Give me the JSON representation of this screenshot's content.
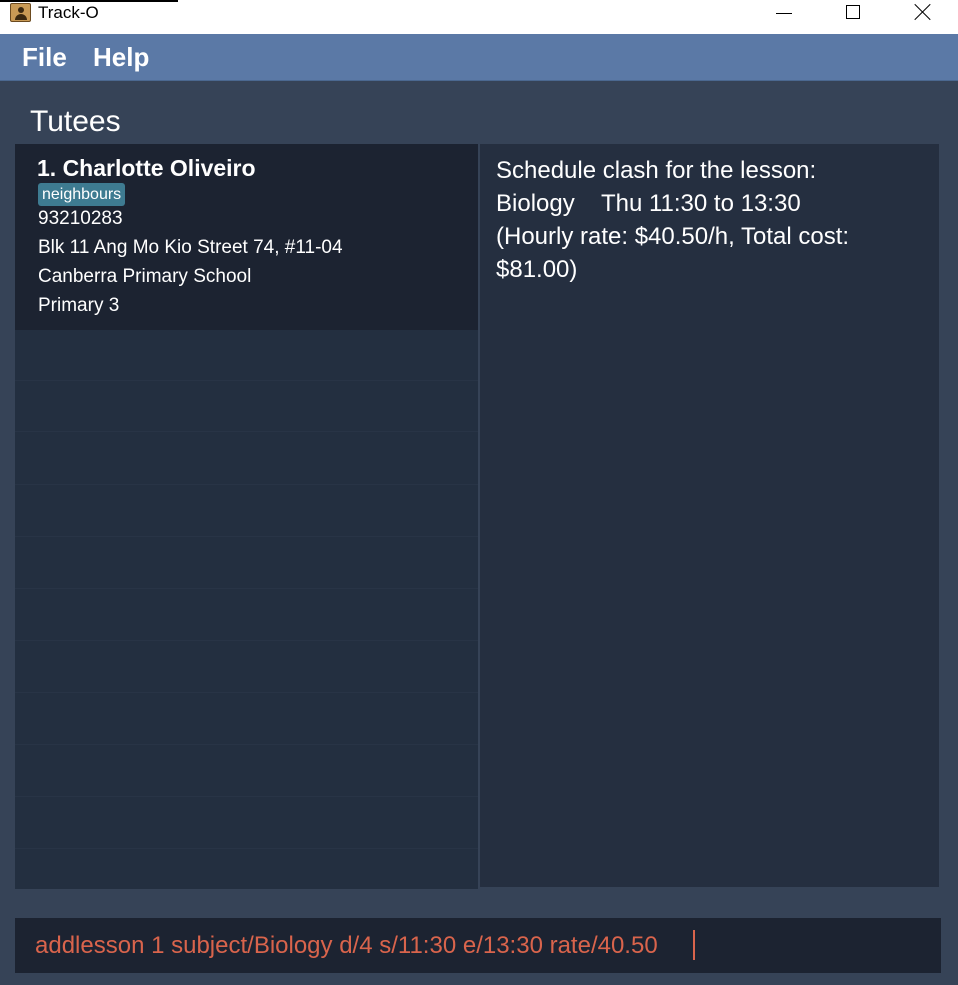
{
  "window": {
    "title": "Track-O",
    "icon": "address-book-icon"
  },
  "menu": {
    "file": "File",
    "help": "Help"
  },
  "main": {
    "section_title": "Tutees"
  },
  "tutees": [
    {
      "index_name": "1.  Charlotte Oliveiro",
      "tag": "neighbours",
      "phone": "93210283",
      "address": "Blk 11 Ang Mo Kio Street 74, #11-04",
      "school": "Canberra Primary School",
      "level": "Primary 3"
    }
  ],
  "result": {
    "message": "Schedule clash for the lesson:\nBiology    Thu 11:30 to 13:30\n(Hourly rate: $40.50/h, Total cost:\n$81.00)"
  },
  "command": {
    "value": "addlesson 1 subject/Biology d/4 s/11:30 e/13:30 rate/40.50"
  },
  "colors": {
    "menubar": "#5b79a6",
    "background": "#364357",
    "card_selected": "#1c2331",
    "tag": "#3e7b91",
    "command_text": "#d9644c"
  }
}
